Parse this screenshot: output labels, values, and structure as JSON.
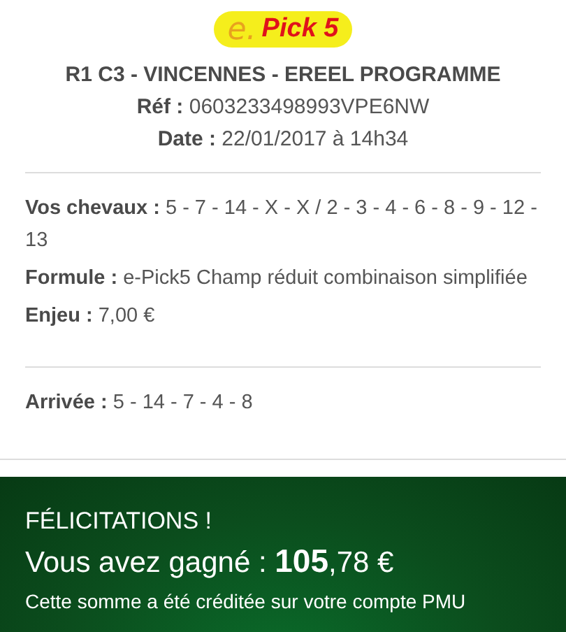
{
  "logo": {
    "prefix": "e.",
    "name": "Pick 5"
  },
  "header": {
    "title": "R1 C3 - VINCENNES - EREEL PROGRAMME",
    "lines": [
      "**Réf :** 0603233498993VPE6NW",
      "**Date :** 22/01/2017 à 14h34"
    ]
  },
  "details": [
    "**Vos chevaux :** 5 - 7 - 14 - X - X / 2 - 3 - 4 - 6 - 8 - 9 - 12 - 13",
    "**Formule :** e-Pick5 Champ réduit combinaison simplifiée",
    "**Enjeu :** 7,00 €"
  ],
  "result": "**Arrivée :** 5 - 14 - 7 - 4 - 8",
  "win_banner": {
    "title": "FÉLICITATIONS !",
    "amount": "Vous avez gagné : **105**,78 €",
    "note": "Cette somme a été créditée sur votre compte PMU"
  }
}
